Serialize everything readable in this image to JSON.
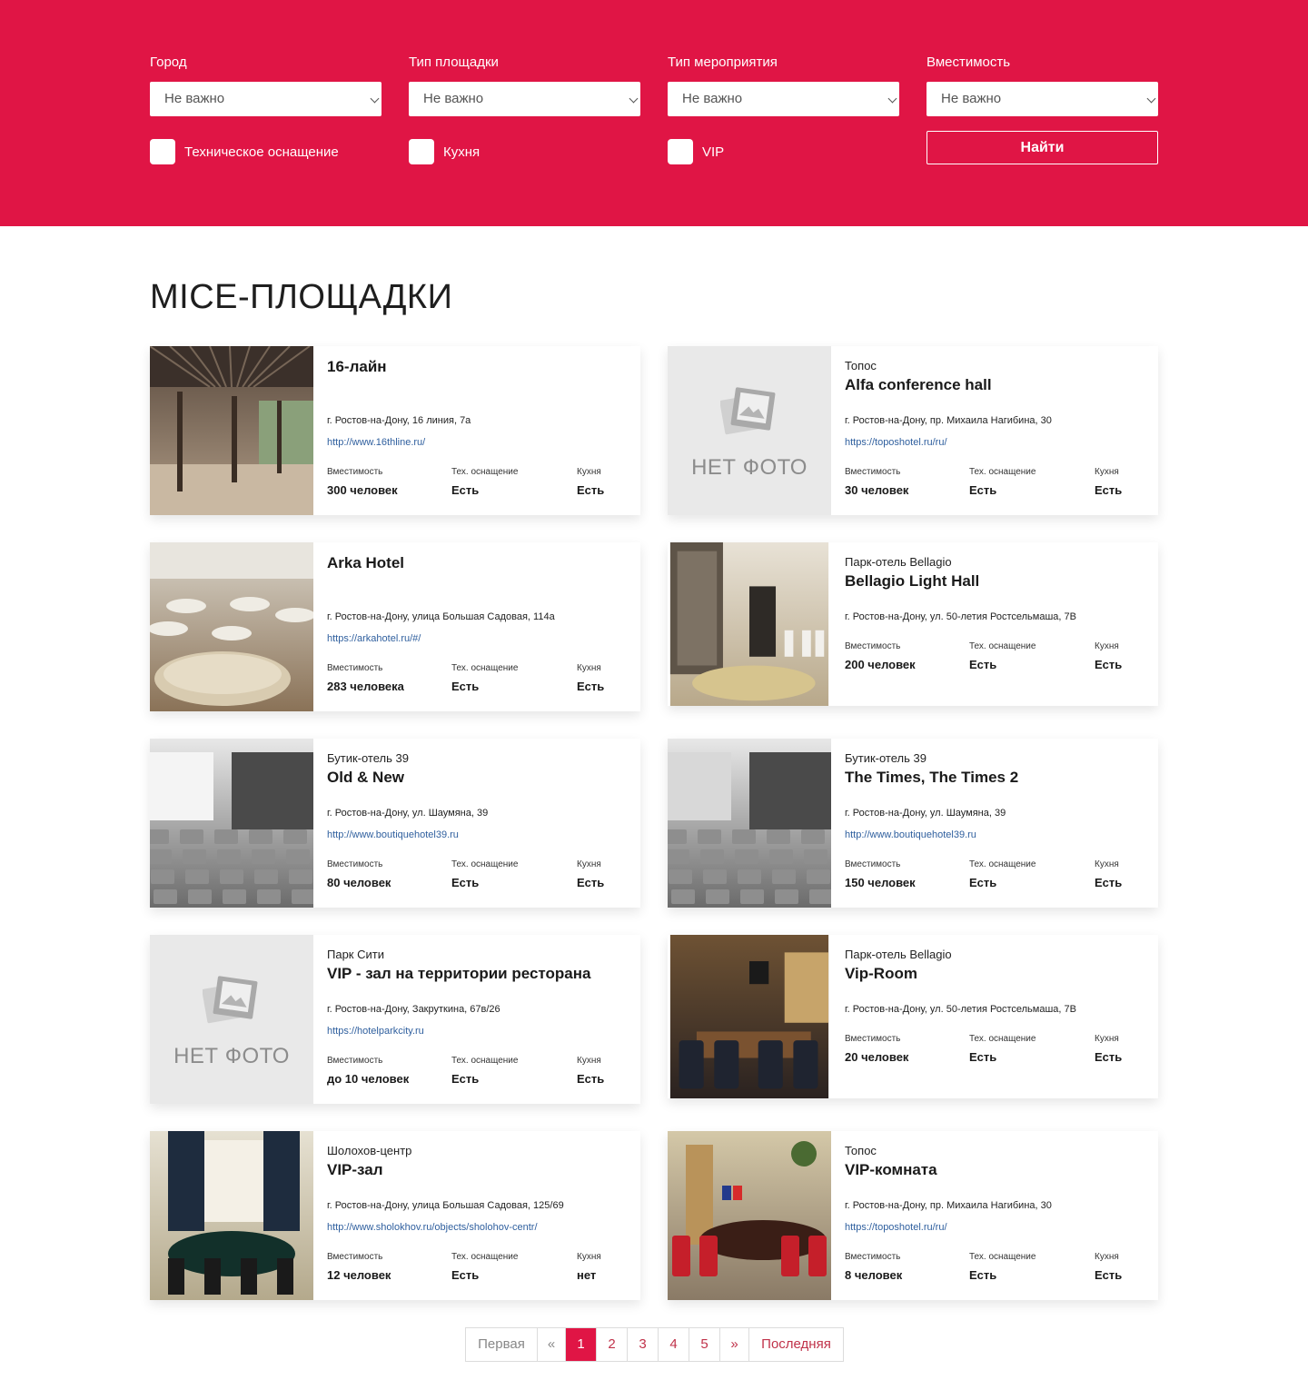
{
  "filters": {
    "city": {
      "label": "Город",
      "value": "Не важно"
    },
    "venue_type": {
      "label": "Тип площадки",
      "value": "Не важно"
    },
    "event_type": {
      "label": "Тип мероприятия",
      "value": "Не важно"
    },
    "capacity": {
      "label": "Вместимость",
      "value": "Не важно"
    },
    "checkbox_tech": "Техническое оснащение",
    "checkbox_kitchen": "Кухня",
    "checkbox_vip": "VIP",
    "find_button": "Найти"
  },
  "page_title": "MICE-ПЛОЩАДКИ",
  "stat_labels": {
    "capacity": "Вместимость",
    "tech": "Тех. оснащение",
    "kitchen": "Кухня"
  },
  "no_photo_text": "НЕТ ФОТО",
  "venues": [
    {
      "brand": "",
      "name": "16-лайн",
      "address": "г. Ростов-на-Дону, 16 линия, 7а",
      "url": "http://www.16thline.ru/",
      "capacity": "300 человек",
      "tech": "Есть",
      "kitchen": "Есть",
      "photo": "terrace"
    },
    {
      "brand": "Топос",
      "name": "Alfa conference hall",
      "address": "г. Ростов-на-Дону, пр. Михаила Нагибина, 30",
      "url": "https://toposhotel.ru/ru/",
      "capacity": "30 человек",
      "tech": "Есть",
      "kitchen": "Есть",
      "photo": "none"
    },
    {
      "brand": "",
      "name": "Arka Hotel",
      "address": "г. Ростов-на-Дону, улица Большая Садовая, 114а",
      "url": "https://arkahotel.ru/#/",
      "capacity": "283 человека",
      "tech": "Есть",
      "kitchen": "Есть",
      "photo": "banquet"
    },
    {
      "brand": "Парк-отель Bellagio",
      "name": "Bellagio Light Hall",
      "address": "г. Ростов-на-Дону, ул. 50-летия Ростсельмаша, 7В",
      "url": "",
      "capacity": "200 человек",
      "tech": "Есть",
      "kitchen": "Есть",
      "photo": "hall"
    },
    {
      "brand": "Бутик-отель 39",
      "name": "Old & New",
      "address": "г. Ростов-на-Дону, ул. Шаумяна, 39",
      "url": "http://www.boutiquehotel39.ru",
      "capacity": "80 человек",
      "tech": "Есть",
      "kitchen": "Есть",
      "photo": "conference"
    },
    {
      "brand": "Бутик-отель 39",
      "name": "The Times, The Times 2",
      "address": "г. Ростов-на-Дону, ул. Шаумяна, 39",
      "url": "http://www.boutiquehotel39.ru",
      "capacity": "150 человек",
      "tech": "Есть",
      "kitchen": "Есть",
      "photo": "conference2"
    },
    {
      "brand": "Парк Сити",
      "name": "VIP - зал на территории ресторана",
      "address": "г. Ростов-на-Дону, Закруткина, 67в/26",
      "url": "https://hotelparkcity.ru",
      "capacity": "до 10 человек",
      "tech": "Есть",
      "kitchen": "Есть",
      "photo": "none"
    },
    {
      "brand": "Парк-отель Bellagio",
      "name": "Vip-Room",
      "address": "г. Ростов-на-Дону, ул. 50-летия Ростсельмаша, 7В",
      "url": "",
      "capacity": "20 человек",
      "tech": "Есть",
      "kitchen": "Есть",
      "photo": "viproom"
    },
    {
      "brand": "Шолохов-центр",
      "name": "VIP-зал",
      "address": "г. Ростов-на-Дону, улица Большая Садовая, 125/69",
      "url": "http://www.sholokhov.ru/objects/sholohov-centr/",
      "capacity": "12 человек",
      "tech": "Есть",
      "kitchen": "нет",
      "photo": "round"
    },
    {
      "brand": "Топос",
      "name": "VIP-комната",
      "address": "г. Ростов-на-Дону, пр. Михаила Нагибина, 30",
      "url": "https://toposhotel.ru/ru/",
      "capacity": "8 человек",
      "tech": "Есть",
      "kitchen": "Есть",
      "photo": "meeting"
    }
  ],
  "pagination": {
    "first": "Первая",
    "prev": "«",
    "pages": [
      "1",
      "2",
      "3",
      "4",
      "5"
    ],
    "active": "1",
    "next": "»",
    "last": "Последняя"
  },
  "colors": {
    "accent": "#e01545",
    "link": "#2f5f9e"
  }
}
